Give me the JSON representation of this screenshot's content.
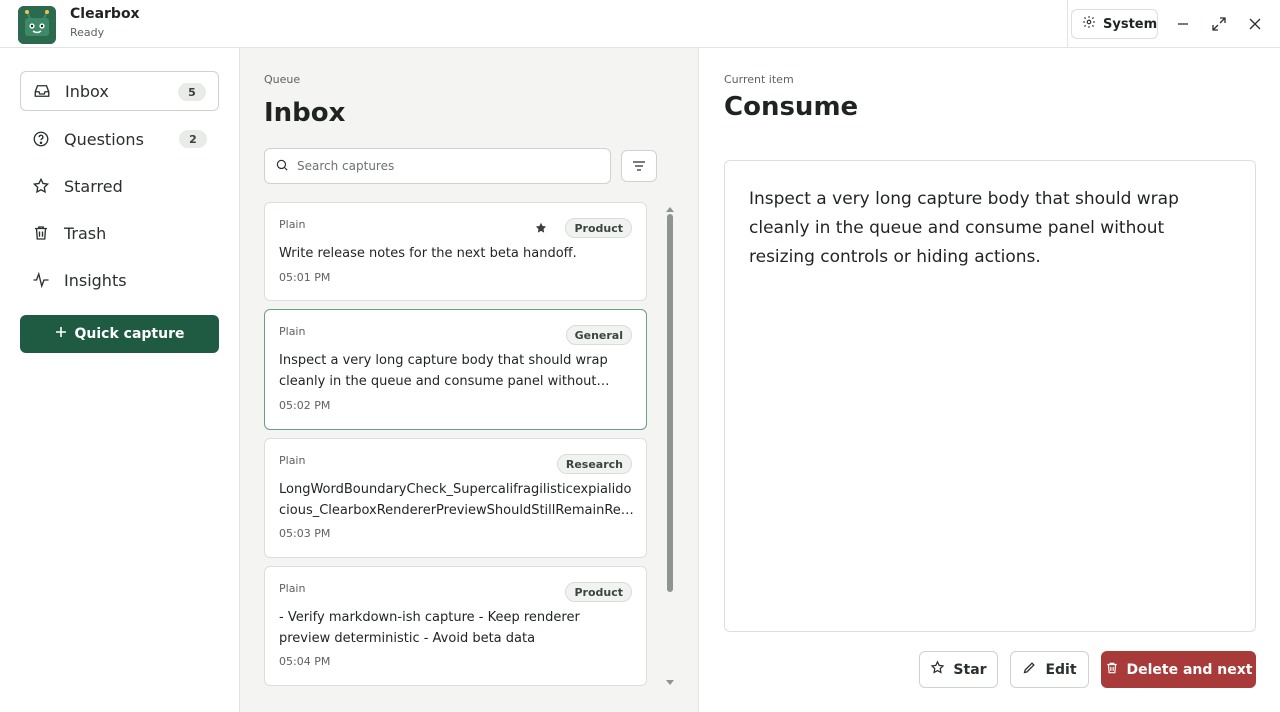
{
  "app": {
    "name": "Clearbox",
    "status": "Ready"
  },
  "titlebar": {
    "theme_label": "System"
  },
  "sidebar": {
    "items": [
      {
        "label": "Inbox",
        "badge": "5"
      },
      {
        "label": "Questions",
        "badge": "2"
      },
      {
        "label": "Starred"
      },
      {
        "label": "Trash"
      },
      {
        "label": "Insights"
      }
    ],
    "quick_capture": "Quick capture"
  },
  "queue": {
    "kicker": "Queue",
    "title": "Inbox",
    "search_placeholder": "Search captures",
    "cards": [
      {
        "kind": "Plain",
        "tag": "Product",
        "starred": true,
        "body": "Write release notes for the next beta handoff.",
        "time": "05:01 PM"
      },
      {
        "kind": "Plain",
        "tag": "General",
        "starred": false,
        "body": "Inspect a very long capture body that should wrap cleanly in the queue and consume panel without resizing controls or hiding actions.",
        "time": "05:02 PM"
      },
      {
        "kind": "Plain",
        "tag": "Research",
        "starred": false,
        "body": "LongWordBoundaryCheck_Supercalifragilisticexpialidocious_ClearboxRendererPreviewShouldStillRemainReadable",
        "time": "05:03 PM"
      },
      {
        "kind": "Plain",
        "tag": "Product",
        "starred": false,
        "body": "- Verify markdown-ish capture - Keep renderer preview deterministic - Avoid beta data",
        "time": "05:04 PM"
      }
    ]
  },
  "consume": {
    "kicker": "Current item",
    "title": "Consume",
    "body": "Inspect a very long capture body that should wrap cleanly in the queue and consume panel without resizing controls or hiding actions.",
    "star_label": "Star",
    "edit_label": "Edit",
    "delete_label": "Delete and next"
  },
  "colors": {
    "accent": "#1f5a43",
    "danger": "#a83a3a",
    "queue_bg": "#f4f5f3"
  }
}
